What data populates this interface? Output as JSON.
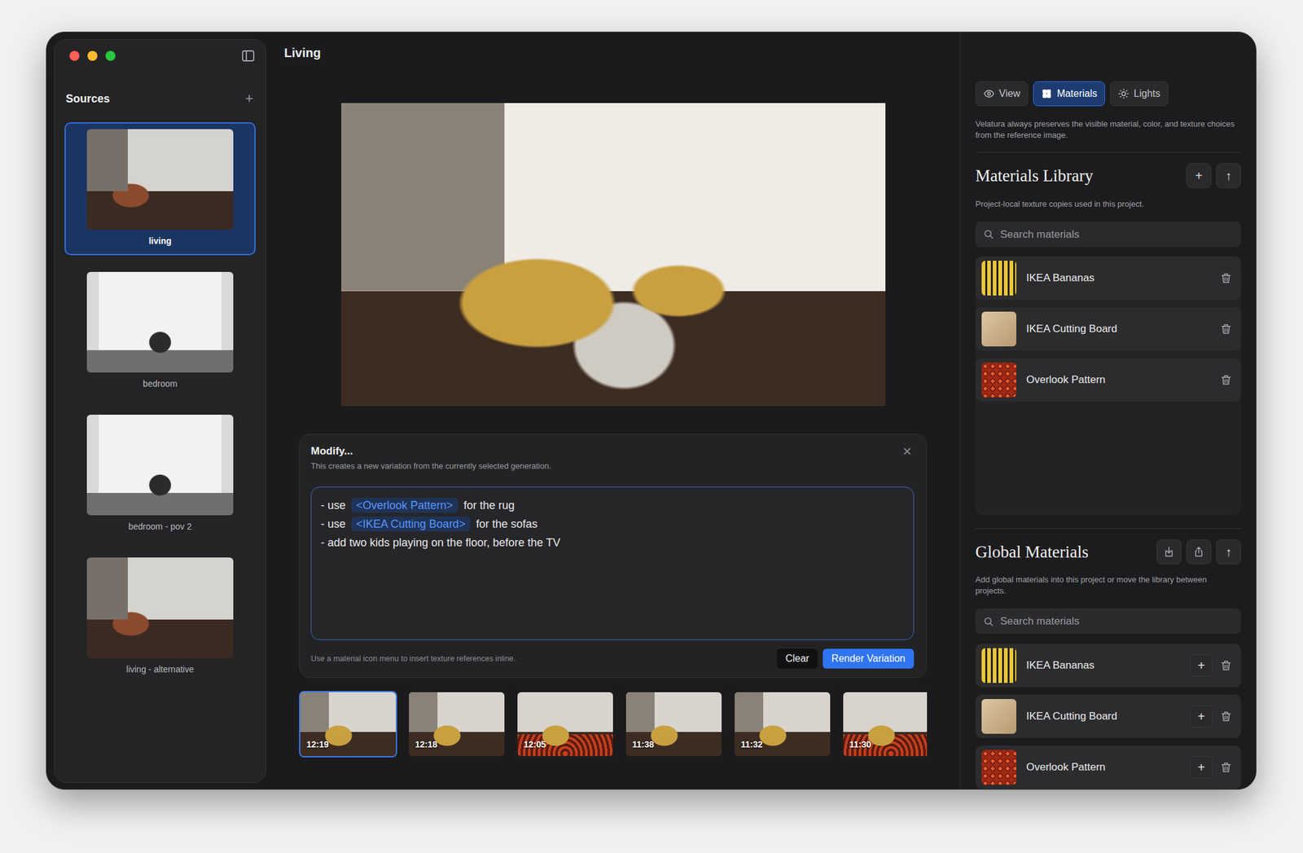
{
  "window": {
    "title": "Living"
  },
  "sidebar": {
    "title": "Sources",
    "add": "+",
    "items": [
      {
        "label": "living",
        "selected": true,
        "kind": "living"
      },
      {
        "label": "bedroom",
        "selected": false,
        "kind": "bedroom"
      },
      {
        "label": "bedroom - pov 2",
        "selected": false,
        "kind": "bedroom"
      },
      {
        "label": "living - alternative",
        "selected": false,
        "kind": "living"
      }
    ]
  },
  "modify": {
    "title": "Modify...",
    "subtitle": "This creates a new variation from the currently selected generation.",
    "close": "×",
    "lines": [
      [
        {
          "kind": "text",
          "text": "- use "
        },
        {
          "kind": "reference",
          "text": "<Overlook Pattern>"
        },
        {
          "kind": "text",
          "text": " for the rug"
        }
      ],
      [
        {
          "kind": "text",
          "text": "- use "
        },
        {
          "kind": "reference",
          "text": "<IKEA Cutting Board>"
        },
        {
          "kind": "text",
          "text": " for the sofas"
        }
      ],
      [
        {
          "kind": "text",
          "text": "- add two kids playing on the floor, before the TV"
        }
      ]
    ],
    "hint": "Use a material icon menu to insert texture references inline.",
    "clear": "Clear",
    "render": "Render Variation"
  },
  "generations": [
    {
      "time": "12:19",
      "selected": true
    },
    {
      "time": "12:18",
      "selected": false
    },
    {
      "time": "12:05",
      "selected": false
    },
    {
      "time": "11:38",
      "selected": false
    },
    {
      "time": "11:32",
      "selected": false
    },
    {
      "time": "11:30",
      "selected": false
    }
  ],
  "inspector": {
    "tabs": [
      {
        "label": "View",
        "selected": false
      },
      {
        "label": "Materials",
        "selected": true
      },
      {
        "label": "Lights",
        "selected": false
      }
    ],
    "note": "Velatura always preserves the visible material, color, and texture choices from the reference image."
  },
  "library": {
    "title": "Materials Library",
    "add": "+",
    "upload": "↑",
    "description": "Project-local texture copies used in this project.",
    "search": {
      "placeholder": "Search materials"
    },
    "items": [
      {
        "name": "IKEA Bananas",
        "kind": "bananas"
      },
      {
        "name": "IKEA Cutting Board",
        "kind": "wood"
      },
      {
        "name": "Overlook Pattern",
        "kind": "pattern"
      }
    ]
  },
  "global": {
    "title": "Global Materials",
    "upload": "↑",
    "description": "Add global materials into this project or move the library between projects.",
    "search": {
      "placeholder": "Search materials"
    },
    "items": [
      {
        "name": "IKEA Bananas",
        "kind": "bananas",
        "add": "+"
      },
      {
        "name": "IKEA Cutting Board",
        "kind": "wood",
        "add": "+"
      },
      {
        "name": "Overlook Pattern",
        "kind": "pattern",
        "add": "+"
      }
    ]
  }
}
